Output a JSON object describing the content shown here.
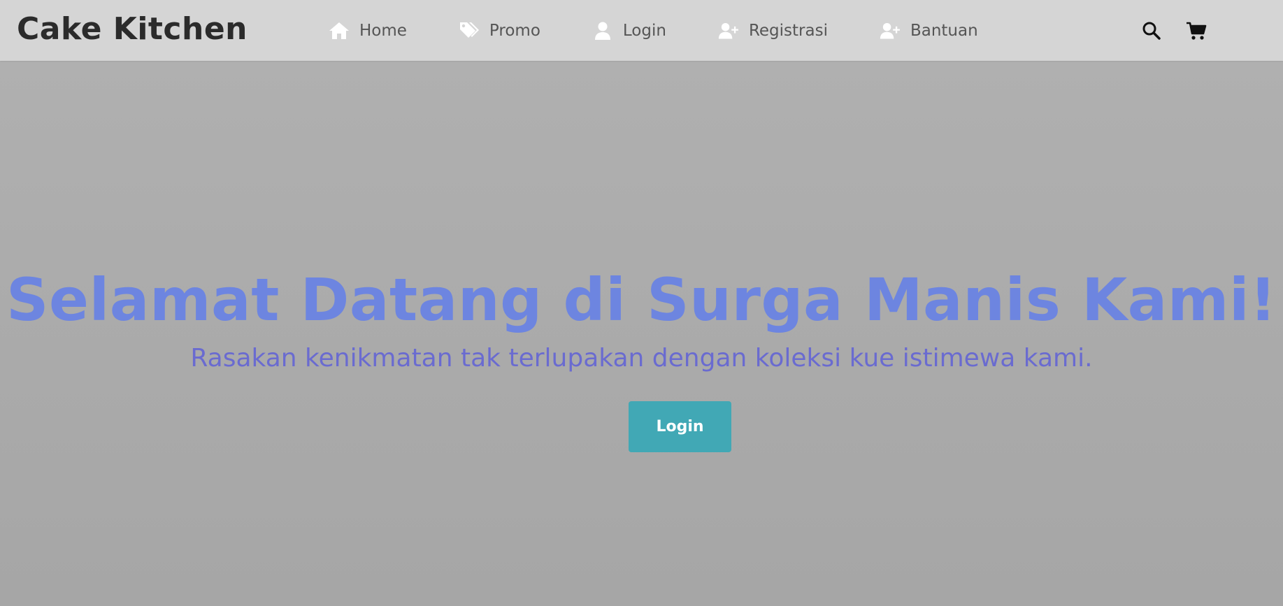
{
  "brand": {
    "name": "Cake Kitchen"
  },
  "nav": {
    "items": [
      {
        "label": "Home",
        "icon": "home-icon"
      },
      {
        "label": "Promo",
        "icon": "tags-icon"
      },
      {
        "label": "Login",
        "icon": "user-icon"
      },
      {
        "label": "Registrasi",
        "icon": "user-plus-icon"
      },
      {
        "label": "Bantuan",
        "icon": "user-plus-icon"
      }
    ]
  },
  "utility": {
    "search_icon": "search-icon",
    "cart_icon": "cart-icon"
  },
  "hero": {
    "title": "Selamat Datang di Surga Manis Kami!",
    "subtitle": "Rasakan kenikmatan tak terlupakan dengan koleksi kue istimewa kami.",
    "button_label": "Login"
  },
  "colors": {
    "navbar_bg": "#d5d5d5",
    "hero_title": "#6d85e0",
    "hero_subtitle": "#6a6bd0",
    "button_bg": "#41a8b5",
    "nav_text": "#555555"
  }
}
